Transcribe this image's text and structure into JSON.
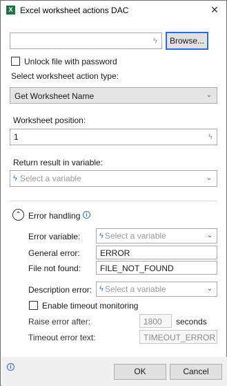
{
  "window": {
    "title": "Excel worksheet actions DAC",
    "app_icon": "X",
    "close_glyph": "✕"
  },
  "file": {
    "path_value": "",
    "browse_label": "Browse..."
  },
  "unlock": {
    "label": "Unlock file with password",
    "checked": false
  },
  "action_type": {
    "label": "Select worksheet action type:",
    "selected": "Get Worksheet Name"
  },
  "worksheet_position": {
    "label": "Worksheet position:",
    "value": "1"
  },
  "return_result": {
    "label": "Return result in variable:",
    "placeholder": "Select a variable"
  },
  "error_handling": {
    "label": "Error handling",
    "info_glyph": "i",
    "error_variable_label": "Error variable:",
    "error_variable_placeholder": "Select a variable",
    "general_error_label": "General error:",
    "general_error_value": "ERROR",
    "file_not_found_label": "File not found:",
    "file_not_found_value": "FILE_NOT_FOUND",
    "description_error_label": "Description error:",
    "description_error_placeholder": "Select a variable",
    "timeout_label": "Enable timeout monitoring",
    "timeout_checked": false,
    "raise_after_label": "Raise error after:",
    "raise_after_value": "1800",
    "raise_after_unit": "seconds",
    "timeout_text_label": "Timeout error text:",
    "timeout_text_value": "TIMEOUT_ERROR"
  },
  "footer": {
    "info_glyph": "i",
    "ok_label": "OK",
    "cancel_label": "Cancel"
  },
  "colors": {
    "accent": "#2a6fd6",
    "excel_green": "#1f7244",
    "footer_bg": "#f0f0f0"
  }
}
